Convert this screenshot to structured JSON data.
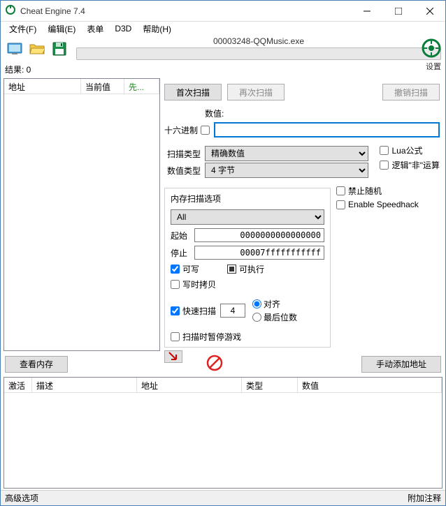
{
  "title": "Cheat Engine 7.4",
  "menu": {
    "file": "文件(F)",
    "edit": "编辑(E)",
    "table": "表单",
    "d3d": "D3D",
    "help": "帮助(H)"
  },
  "process_name": "00003248-QQMusic.exe",
  "settings_label": "设置",
  "results_label": "结果: 0",
  "results_cols": {
    "address": "地址",
    "value": "当前值",
    "prev": "先..."
  },
  "scan": {
    "first": "首次扫描",
    "next": "再次扫描",
    "undo": "撤销扫描",
    "value_label": "数值:",
    "hex_label": "十六进制",
    "scan_type_label": "扫描类型",
    "scan_type": "精确数值",
    "value_type_label": "数值类型",
    "value_type": "4 字节",
    "lua": "Lua公式",
    "not_op": "逻辑\"非\"运算"
  },
  "mem": {
    "title": "内存扫描选项",
    "all": "All",
    "start_label": "起始",
    "start": "0000000000000000",
    "stop_label": "停止",
    "stop": "00007fffffffffff",
    "writable": "可写",
    "executable": "可执行",
    "cow": "写时拷贝",
    "fast_scan": "快速扫描",
    "fast_val": "4",
    "align": "对齐",
    "last_digits": "最后位数",
    "pause": "扫描时暂停游戏"
  },
  "right_checks": {
    "no_random": "禁止随机",
    "speedhack": "Enable Speedhack"
  },
  "midbar": {
    "view_mem": "查看内存",
    "add_manual": "手动添加地址"
  },
  "bottom_cols": {
    "active": "激活",
    "desc": "描述",
    "address": "地址",
    "type": "类型",
    "value": "数值"
  },
  "status": {
    "left": "高级选项",
    "right": "附加注释"
  }
}
